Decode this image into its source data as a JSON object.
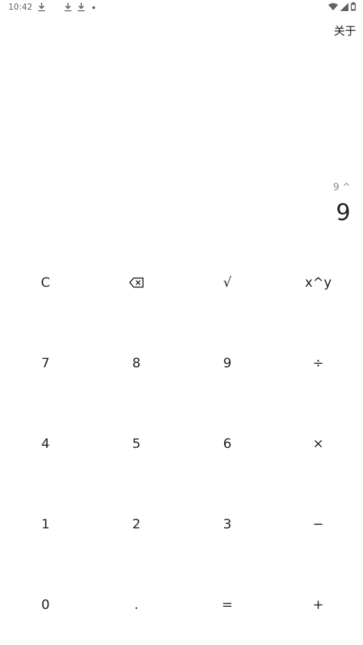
{
  "status_bar": {
    "time": "10:42",
    "left_icons": [
      "download-icon",
      "download-icon",
      "download-icon",
      "notification-dot-icon"
    ],
    "right_icons": [
      "wifi-icon",
      "signal-icon",
      "battery-icon"
    ]
  },
  "app_bar": {
    "about_label": "关于"
  },
  "display": {
    "expression": "9 ^",
    "result": "9"
  },
  "keypad": {
    "rows": [
      [
        {
          "name": "clear",
          "label": "C"
        },
        {
          "name": "backspace",
          "label": "",
          "icon": "backspace-icon"
        },
        {
          "name": "sqrt",
          "label": "√"
        },
        {
          "name": "power",
          "label": "x^y"
        }
      ],
      [
        {
          "name": "digit-7",
          "label": "7"
        },
        {
          "name": "digit-8",
          "label": "8"
        },
        {
          "name": "digit-9",
          "label": "9"
        },
        {
          "name": "divide",
          "label": "÷"
        }
      ],
      [
        {
          "name": "digit-4",
          "label": "4"
        },
        {
          "name": "digit-5",
          "label": "5"
        },
        {
          "name": "digit-6",
          "label": "6"
        },
        {
          "name": "multiply",
          "label": "×"
        }
      ],
      [
        {
          "name": "digit-1",
          "label": "1"
        },
        {
          "name": "digit-2",
          "label": "2"
        },
        {
          "name": "digit-3",
          "label": "3"
        },
        {
          "name": "subtract",
          "label": "−"
        }
      ],
      [
        {
          "name": "digit-0",
          "label": "0"
        },
        {
          "name": "decimal",
          "label": "."
        },
        {
          "name": "equals",
          "label": "="
        },
        {
          "name": "add",
          "label": "+"
        }
      ]
    ]
  }
}
